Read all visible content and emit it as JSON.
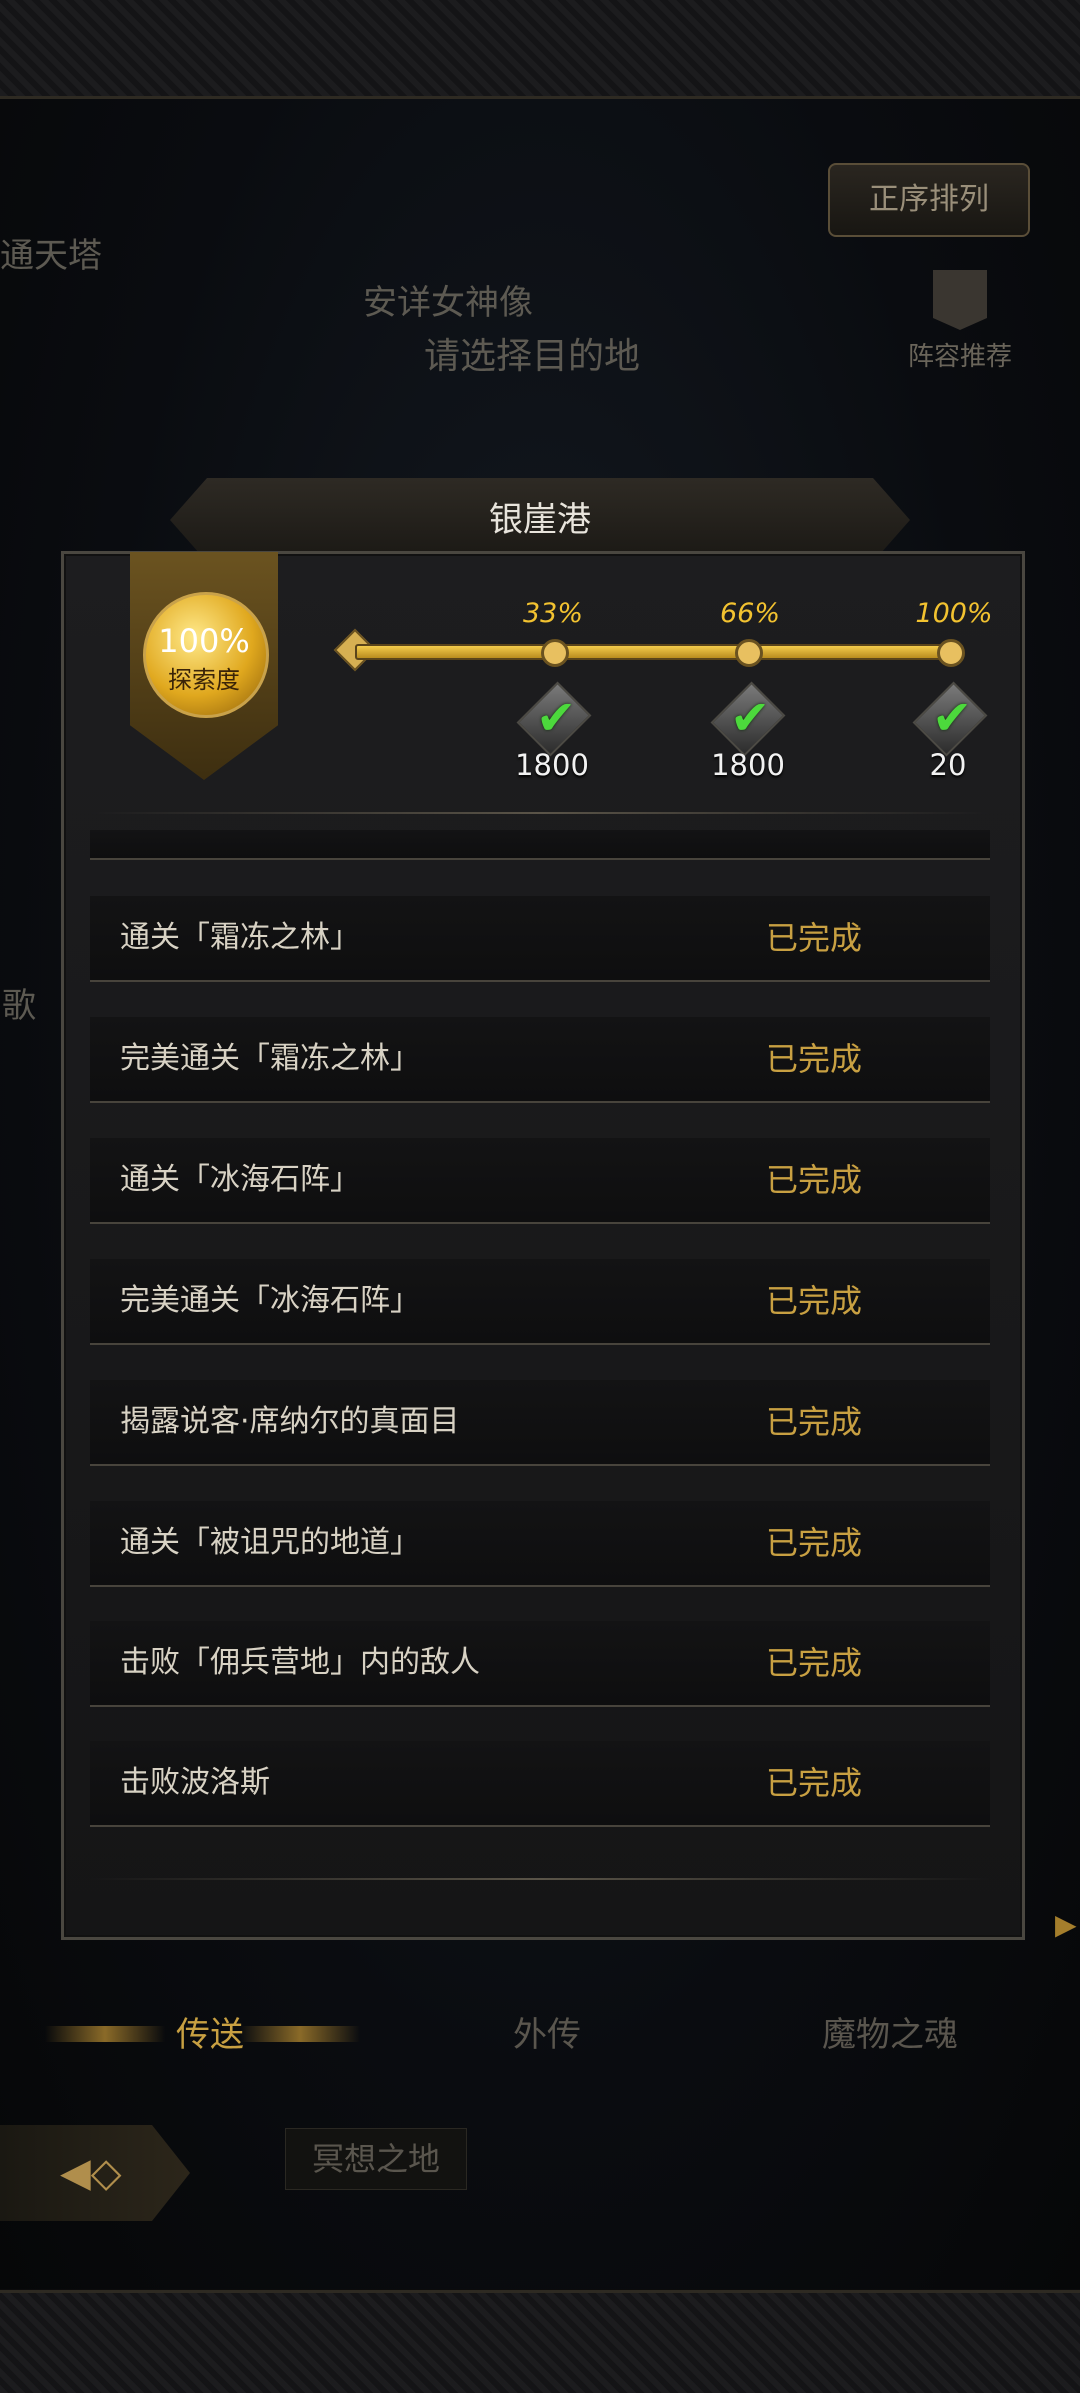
{
  "background": {
    "tower_label": "通天塔",
    "statue_label": "安详女神像",
    "select_dest": "请选择目的地",
    "side_char": "歌",
    "sort_button": "正序排列",
    "lineup_button": "阵容推荐"
  },
  "panel": {
    "title": "银崖港",
    "exploration": {
      "percent": "100%",
      "label": "探索度",
      "milestones": [
        {
          "percent": "33%",
          "reward_count": "1800",
          "claimed": true
        },
        {
          "percent": "66%",
          "reward_count": "1800",
          "claimed": true
        },
        {
          "percent": "100%",
          "reward_count": "20",
          "claimed": true
        }
      ]
    },
    "tasks": [
      {
        "task": "通关「霜冻之林」",
        "status": "已完成"
      },
      {
        "task": "完美通关「霜冻之林」",
        "status": "已完成"
      },
      {
        "task": "通关「冰海石阵」",
        "status": "已完成"
      },
      {
        "task": "完美通关「冰海石阵」",
        "status": "已完成"
      },
      {
        "task": "揭露说客·席纳尔的真面目",
        "status": "已完成"
      },
      {
        "task": "通关「被诅咒的地道」",
        "status": "已完成"
      },
      {
        "task": "击败「佣兵营地」内的敌人",
        "status": "已完成"
      },
      {
        "task": "击败波洛斯",
        "status": "已完成"
      }
    ]
  },
  "bottom_nav": {
    "tabs": [
      "传送",
      "外传",
      "魔物之魂"
    ],
    "active_tab": "传送",
    "sub_tab": "冥想之地"
  },
  "colors": {
    "accent_gold": "#c8a042",
    "progress_gold": "#f2c230",
    "check_green": "#4cd93c"
  }
}
